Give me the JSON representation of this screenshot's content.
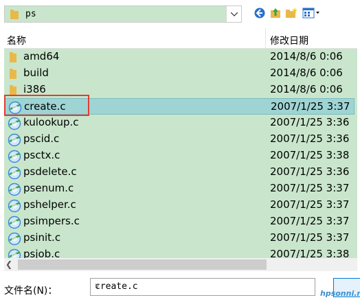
{
  "toolbar": {
    "path": "ps",
    "icons": [
      "back-icon",
      "up-folder-icon",
      "new-folder-icon",
      "view-menu-icon"
    ]
  },
  "columns": {
    "name": "名称",
    "date": "修改日期"
  },
  "files": [
    {
      "name": "amd64",
      "date": "2014/8/6 0:06",
      "type": "folder"
    },
    {
      "name": "build",
      "date": "2014/8/6 0:06",
      "type": "folder"
    },
    {
      "name": "i386",
      "date": "2014/8/6 0:06",
      "type": "folder"
    },
    {
      "name": "create.c",
      "date": "2007/1/25 3:37",
      "type": "c-file",
      "selected": true
    },
    {
      "name": "kulookup.c",
      "date": "2007/1/25 3:36",
      "type": "c-file"
    },
    {
      "name": "pscid.c",
      "date": "2007/1/25 3:36",
      "type": "c-file"
    },
    {
      "name": "psctx.c",
      "date": "2007/1/25 3:38",
      "type": "c-file"
    },
    {
      "name": "psdelete.c",
      "date": "2007/1/25 3:36",
      "type": "c-file"
    },
    {
      "name": "psenum.c",
      "date": "2007/1/25 3:37",
      "type": "c-file"
    },
    {
      "name": "pshelper.c",
      "date": "2007/1/25 3:37",
      "type": "c-file"
    },
    {
      "name": "psimpers.c",
      "date": "2007/1/25 3:37",
      "type": "c-file"
    },
    {
      "name": "psinit.c",
      "date": "2007/1/25 3:37",
      "type": "c-file"
    },
    {
      "name": "psjob.c",
      "date": "2007/1/25 3:38",
      "type": "c-file"
    }
  ],
  "filename_field": {
    "label": "文件名(N)：",
    "value": "create.c"
  },
  "watermark": "hpsonni.net",
  "colors": {
    "list_bg": "#c9e6cc",
    "selection": "#9fd4d4",
    "highlight": "#e03c31"
  }
}
